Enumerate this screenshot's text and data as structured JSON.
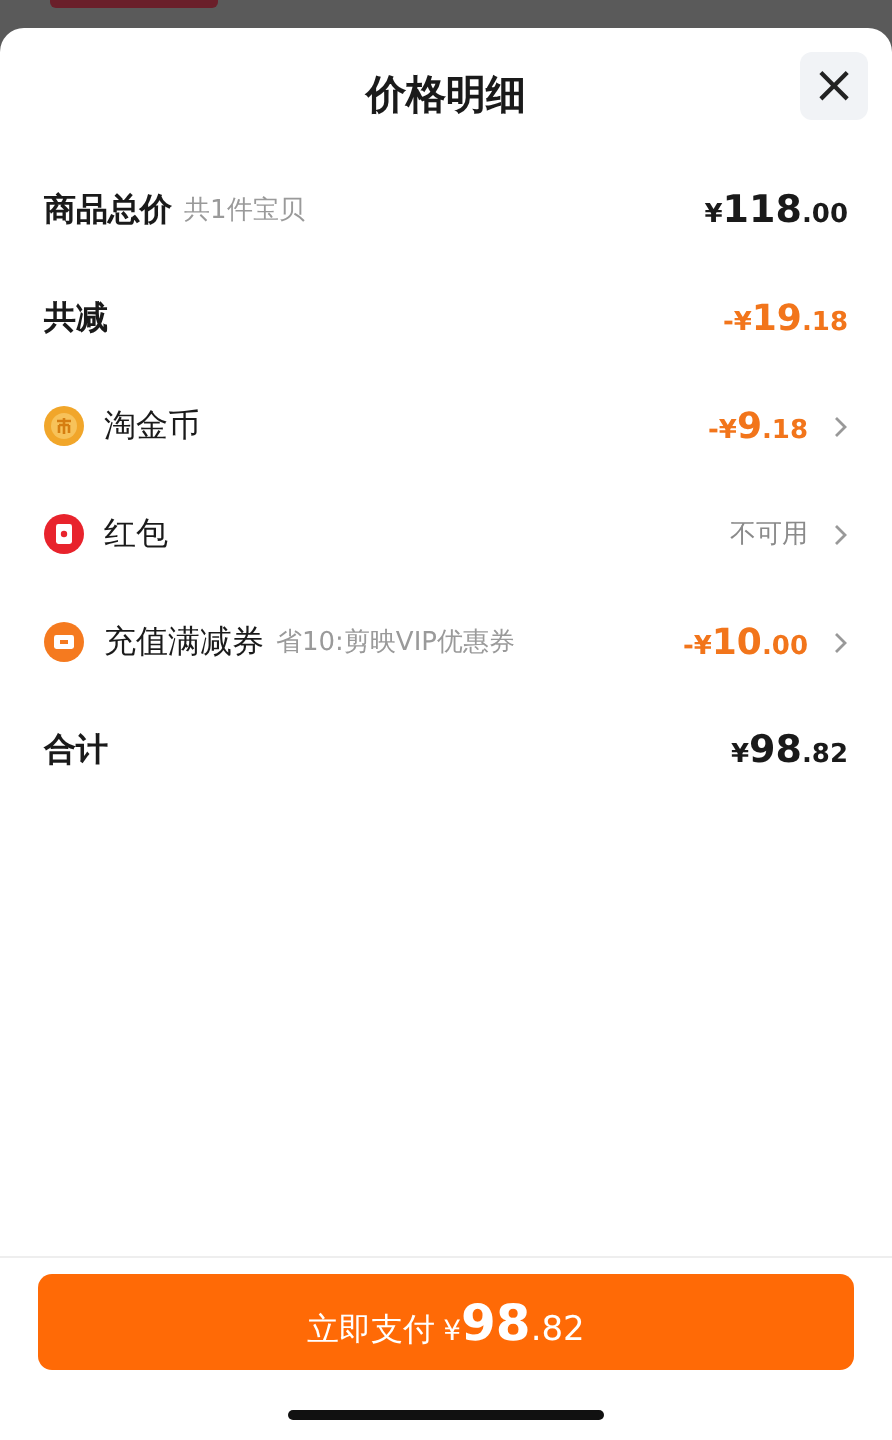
{
  "sheet": {
    "title": "价格明细",
    "close_label": "×"
  },
  "rows": [
    {
      "kind": "summary",
      "label": "商品总价",
      "note": "共1件宝贝",
      "amount": {
        "discount": false,
        "sign": "¥",
        "whole": "118",
        "fraction": ".00"
      },
      "arrow": false
    },
    {
      "kind": "summary",
      "label": "共减",
      "amount": {
        "discount": true,
        "sign": "-¥",
        "whole": "19",
        "fraction": ".18"
      },
      "arrow": false
    },
    {
      "kind": "item",
      "label": "淘金币",
      "amount": {
        "discount": true,
        "sign": "-¥",
        "whole": "9",
        "fraction": ".18"
      },
      "arrow": true
    },
    {
      "kind": "item",
      "label": "红包",
      "status": "不可用",
      "arrow": true
    },
    {
      "kind": "item",
      "label": "充值满减券",
      "note": "省10:剪映VIP优惠券",
      "amount": {
        "discount": true,
        "sign": "-¥",
        "whole": "10",
        "fraction": ".00"
      },
      "arrow": true
    },
    {
      "kind": "summary",
      "label": "合计",
      "amount": {
        "discount": false,
        "sign": "¥",
        "whole": "98",
        "fraction": ".82"
      },
      "arrow": false
    }
  ],
  "pay_button": {
    "label": "立即支付",
    "sign": "¥",
    "whole": "98",
    "fraction": ".82"
  }
}
